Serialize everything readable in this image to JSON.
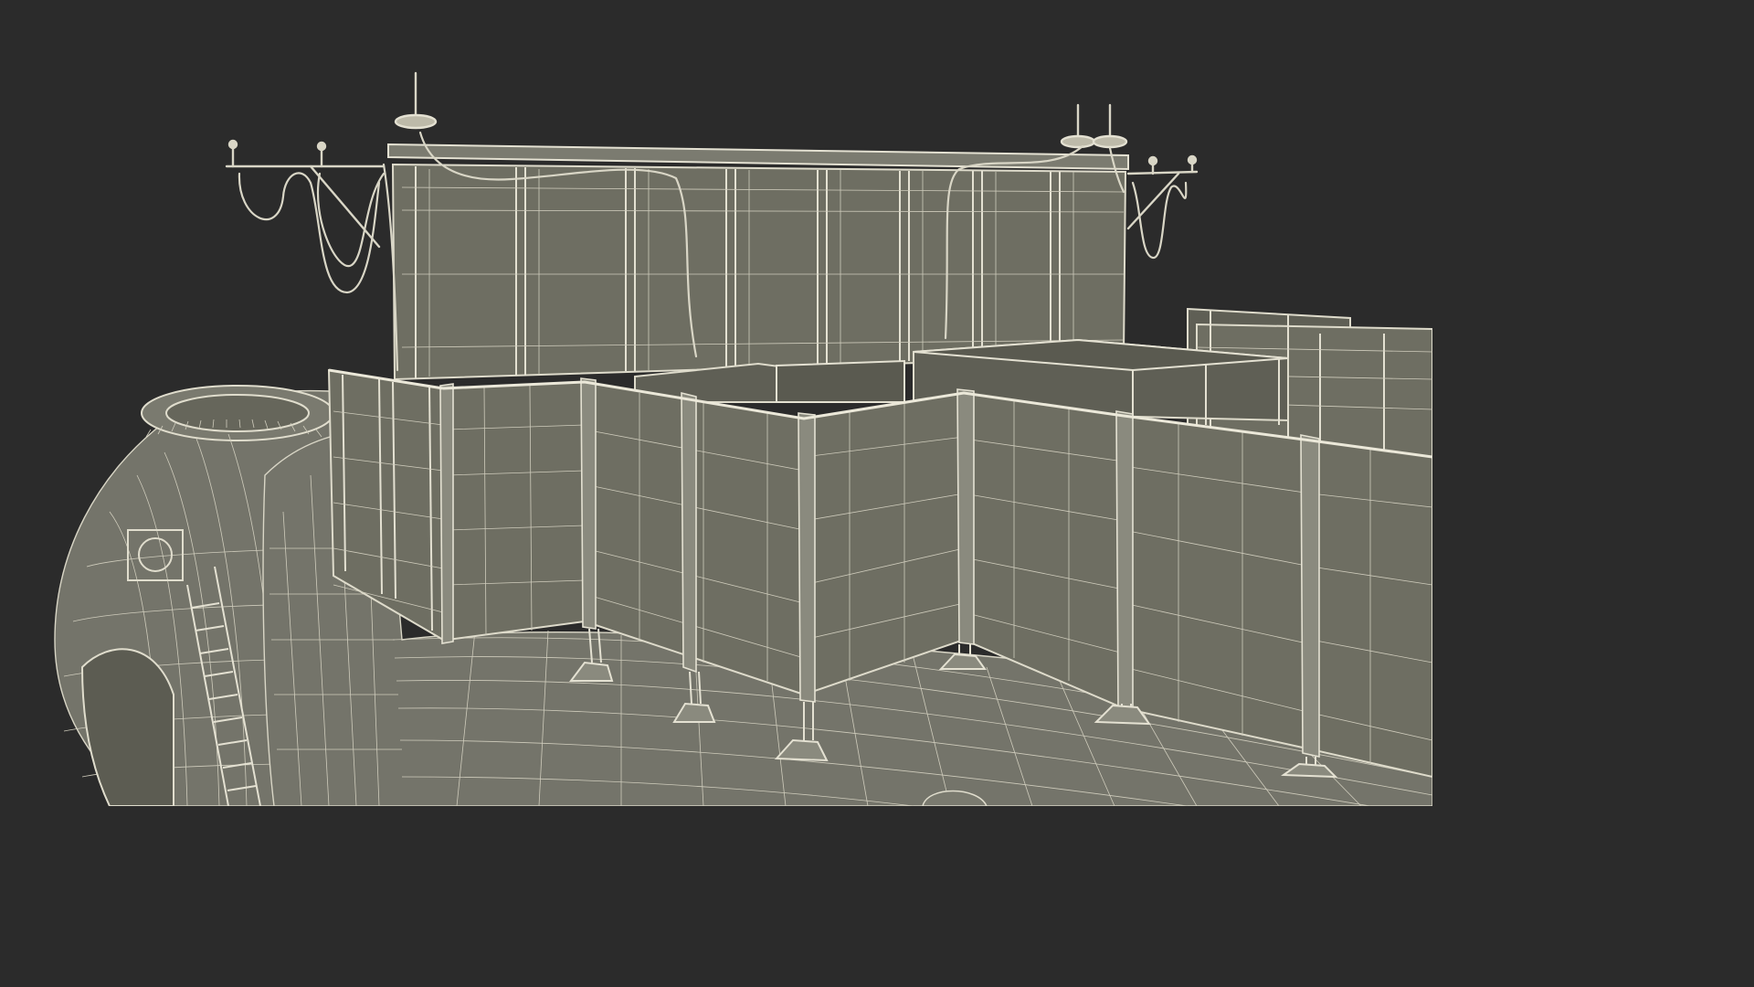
{
  "scene": {
    "background_color": "#2b2b2b",
    "mesh_fill_color": "#6e6e62",
    "wire_color": "#d9d6c6",
    "style": "wireframe-over-shaded"
  }
}
